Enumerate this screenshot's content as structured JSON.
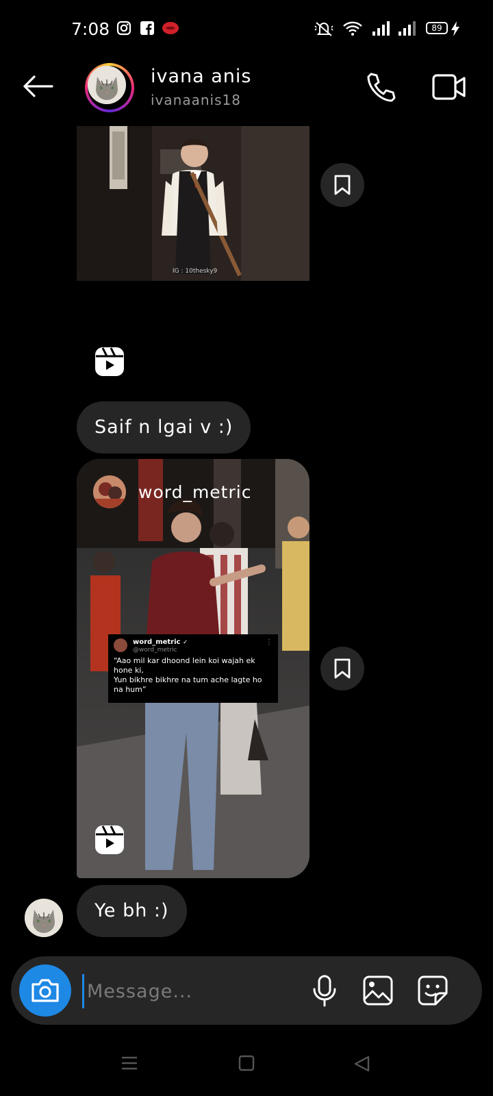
{
  "status_bar": {
    "time": "7:08",
    "battery": "89",
    "icons": [
      "instagram-icon",
      "facebook-icon",
      "notification-app-icon",
      "mute-icon",
      "wifi-icon",
      "signal-icon",
      "signal-icon",
      "battery-icon",
      "charging-icon"
    ]
  },
  "header": {
    "name": "ivana anis",
    "handle": "ivanaanis18",
    "back_icon": "arrow-left-icon",
    "call_icon": "phone-icon",
    "video_icon": "video-camera-icon"
  },
  "messages": [
    {
      "type": "shared-reel",
      "save_icon": "bookmark-icon",
      "reel_icon": "reels-icon",
      "watermark": "IG : 10thesky9"
    },
    {
      "type": "text",
      "text": "Saif n lgai v :)"
    },
    {
      "type": "shared-reel",
      "author": "word_metric",
      "tweet": {
        "name": "word_metric",
        "handle": "@word_metric",
        "text": "“Aao mil kar dhoond lein koi wajah ek hone ki,\n Yun bikhre bikhre na tum ache lagte ho na hum”"
      },
      "save_icon": "bookmark-icon",
      "reel_icon": "reels-icon"
    },
    {
      "type": "text",
      "text": "Ye bh :)"
    }
  ],
  "composer": {
    "placeholder": "Message...",
    "camera_icon": "camera-icon",
    "mic_icon": "microphone-icon",
    "gallery_icon": "image-icon",
    "sticker_icon": "sticker-icon"
  },
  "colors": {
    "background": "#000000",
    "bubble": "#262626",
    "accent": "#1e88e5",
    "secondary_text": "#9a9a9a"
  }
}
